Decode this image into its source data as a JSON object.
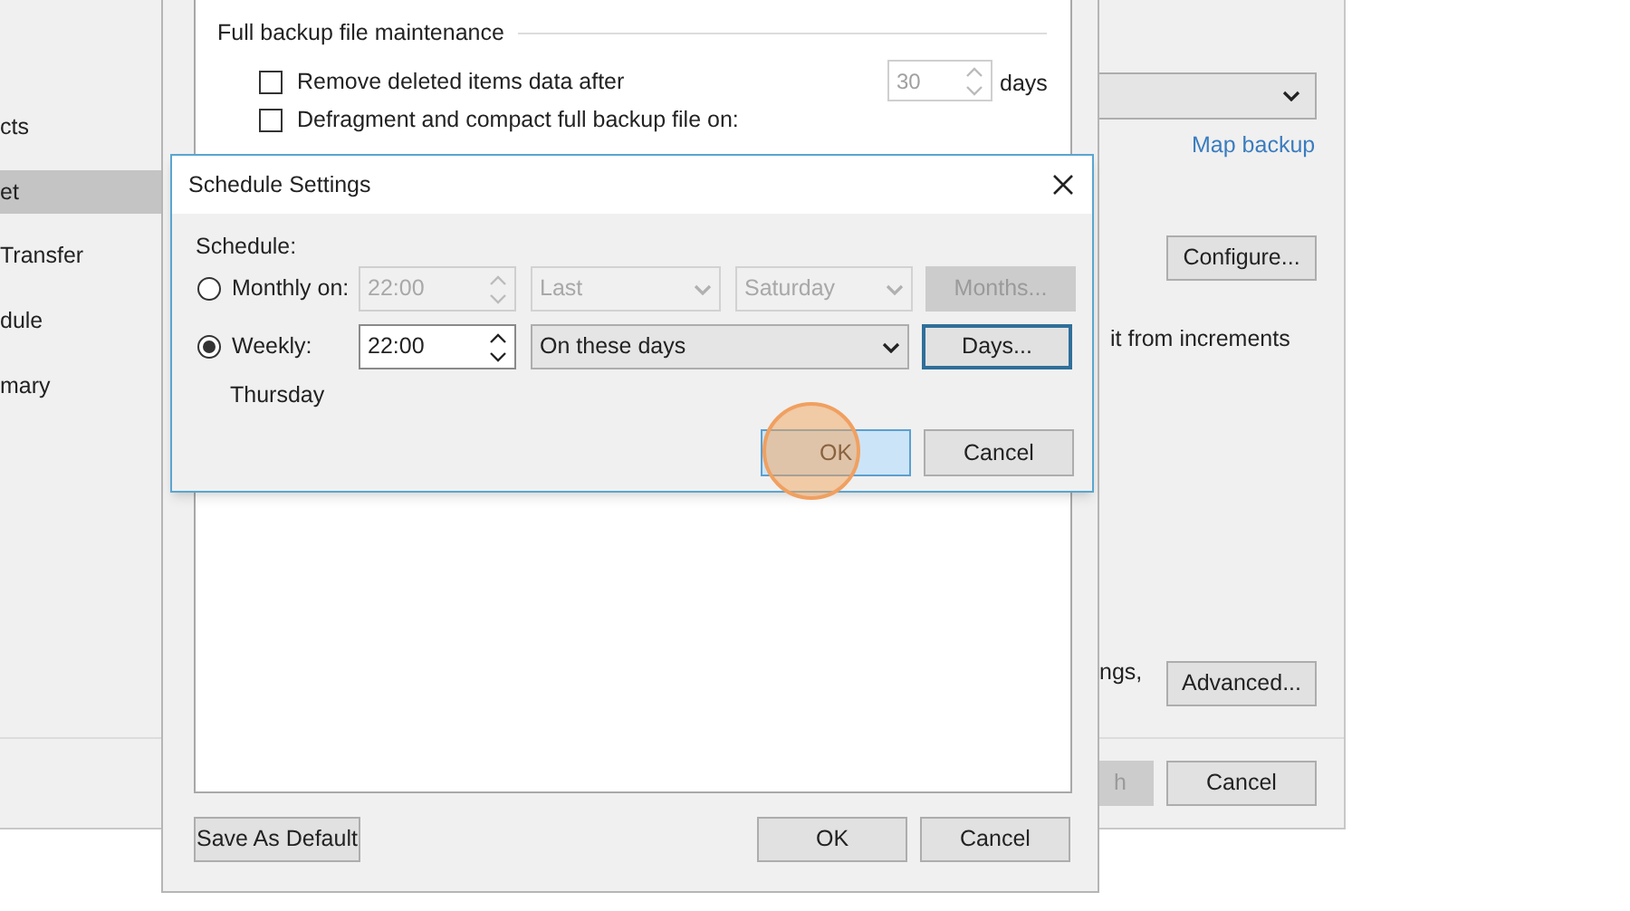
{
  "wizard": {
    "sidebar": {
      "items": [
        {
          "label": "cts",
          "selected": false
        },
        {
          "label": "et",
          "selected": true
        },
        {
          "label": "Transfer",
          "selected": false
        },
        {
          "label": "dule",
          "selected": false
        },
        {
          "label": "mary",
          "selected": false
        }
      ]
    },
    "map_link": "Map backup",
    "configure_button": "Configure...",
    "increments_text": "it from increments",
    "settings_text": "ngs,",
    "advanced_button": "Advanced...",
    "footer_buttons": [
      {
        "label": "h",
        "disabled": true
      },
      {
        "label": "Cancel",
        "disabled": false
      }
    ]
  },
  "advanced": {
    "section_title": "Full backup file maintenance",
    "options": [
      {
        "label": "Remove deleted items data after",
        "checked": false,
        "value": "30",
        "unit": "days"
      },
      {
        "label": "Defragment and compact full backup file on:",
        "checked": false
      }
    ],
    "save_default_button": "Save As Default",
    "footer_buttons": [
      "OK",
      "Cancel"
    ]
  },
  "dialog": {
    "title": "Schedule Settings",
    "schedule_label": "Schedule:",
    "rows": [
      {
        "label": "Monthly on:",
        "selected": false,
        "time": "22:00",
        "selects": [
          "Last",
          "Saturday"
        ],
        "button": "Months..."
      },
      {
        "label": "Weekly:",
        "selected": true,
        "time": "22:00",
        "selects": [
          "On these days"
        ],
        "button": "Days..."
      }
    ],
    "summary": "Thursday",
    "buttons": [
      "OK",
      "Cancel"
    ]
  }
}
